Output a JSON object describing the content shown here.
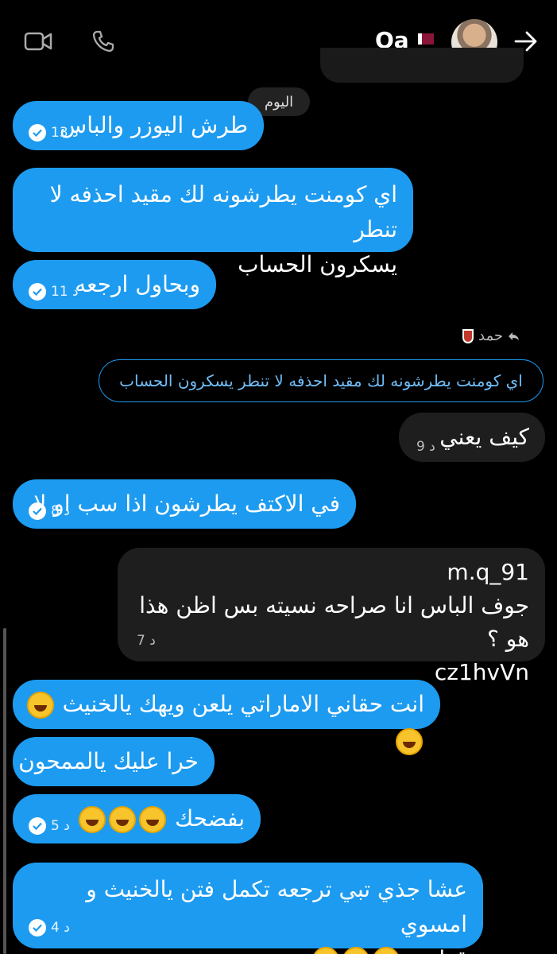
{
  "header": {
    "contact_name": "Qa",
    "flag_icon": "qatar-flag-icon",
    "video_icon": "video-camera-icon",
    "call_icon": "phone-icon",
    "back_icon": "arrow-right-icon"
  },
  "day_separator": "اليوم",
  "messages": [
    {
      "text": "طرش اليوزر والباس",
      "time": "13 د",
      "status": "read"
    },
    {
      "text_line1": "اي كومنت يطرشونه لك مقيد احذفه لا تنطر",
      "text_line2": "يسكرون الحساب"
    },
    {
      "text": "وبحاول ارجعه",
      "time": "11 د",
      "status": "read"
    },
    {
      "reply_to_name": "حمد",
      "quoted": "اي كومنت يطرشونه لك مقيد احذفه لا تنطر يسكرون الحساب",
      "text": "كيف يعني",
      "time": "9 د"
    },
    {
      "text": "في الاكتف يطرشون اذا سب او لا",
      "time": "8 د",
      "status": "read"
    },
    {
      "line1": "m.q_91",
      "line2": "جوف الباس انا صراحه نسيته بس اظن هذا هو ؟",
      "line3": "cz1hvVn",
      "time": "7 د"
    },
    {
      "text": "انت حقاني الاماراتي يلعن ويهك يالخنيث"
    },
    {
      "text": "خرا عليك يالممحون"
    },
    {
      "text": "بفضحك",
      "time": "5 د",
      "status": "read"
    },
    {
      "text_line1": "عشا جذي تبي ترجعه تكمل فتن يالخنيث و امسوي",
      "text_line2": "قطري",
      "time": "4 د",
      "status": "read"
    }
  ],
  "colors": {
    "sent": "#1d9bf0",
    "received": "#1e1e1e",
    "background": "#000000"
  }
}
